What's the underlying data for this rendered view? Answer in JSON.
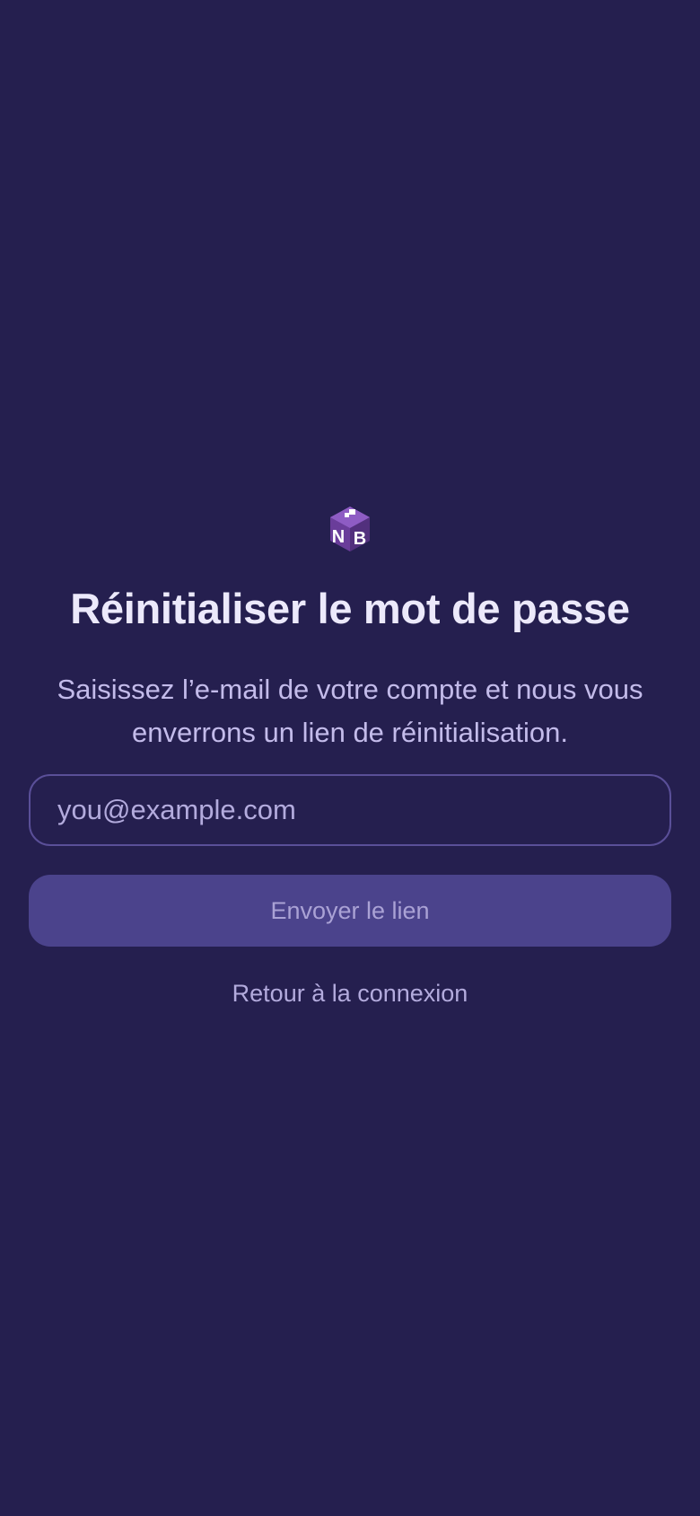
{
  "app": {
    "logo_icon": "nb-cube-logo",
    "logo_text": "NB"
  },
  "reset": {
    "title": "Réinitialiser le mot de passe",
    "subtitle": "Saisissez l’e-mail de votre compte et nous vous enverrons un lien de réinitialisation.",
    "email_placeholder": "you@example.com",
    "email_value": "",
    "send_label": "Envoyer le lien",
    "back_label": "Retour à la connexion"
  },
  "colors": {
    "background": "#251f4f",
    "title": "#ece9fb",
    "subtitle": "#c3bbea",
    "button_bg": "#4b438c",
    "button_text": "#aaa2d5",
    "field_border": "#5a4f98",
    "logo_purple": "#6a3d9a"
  }
}
